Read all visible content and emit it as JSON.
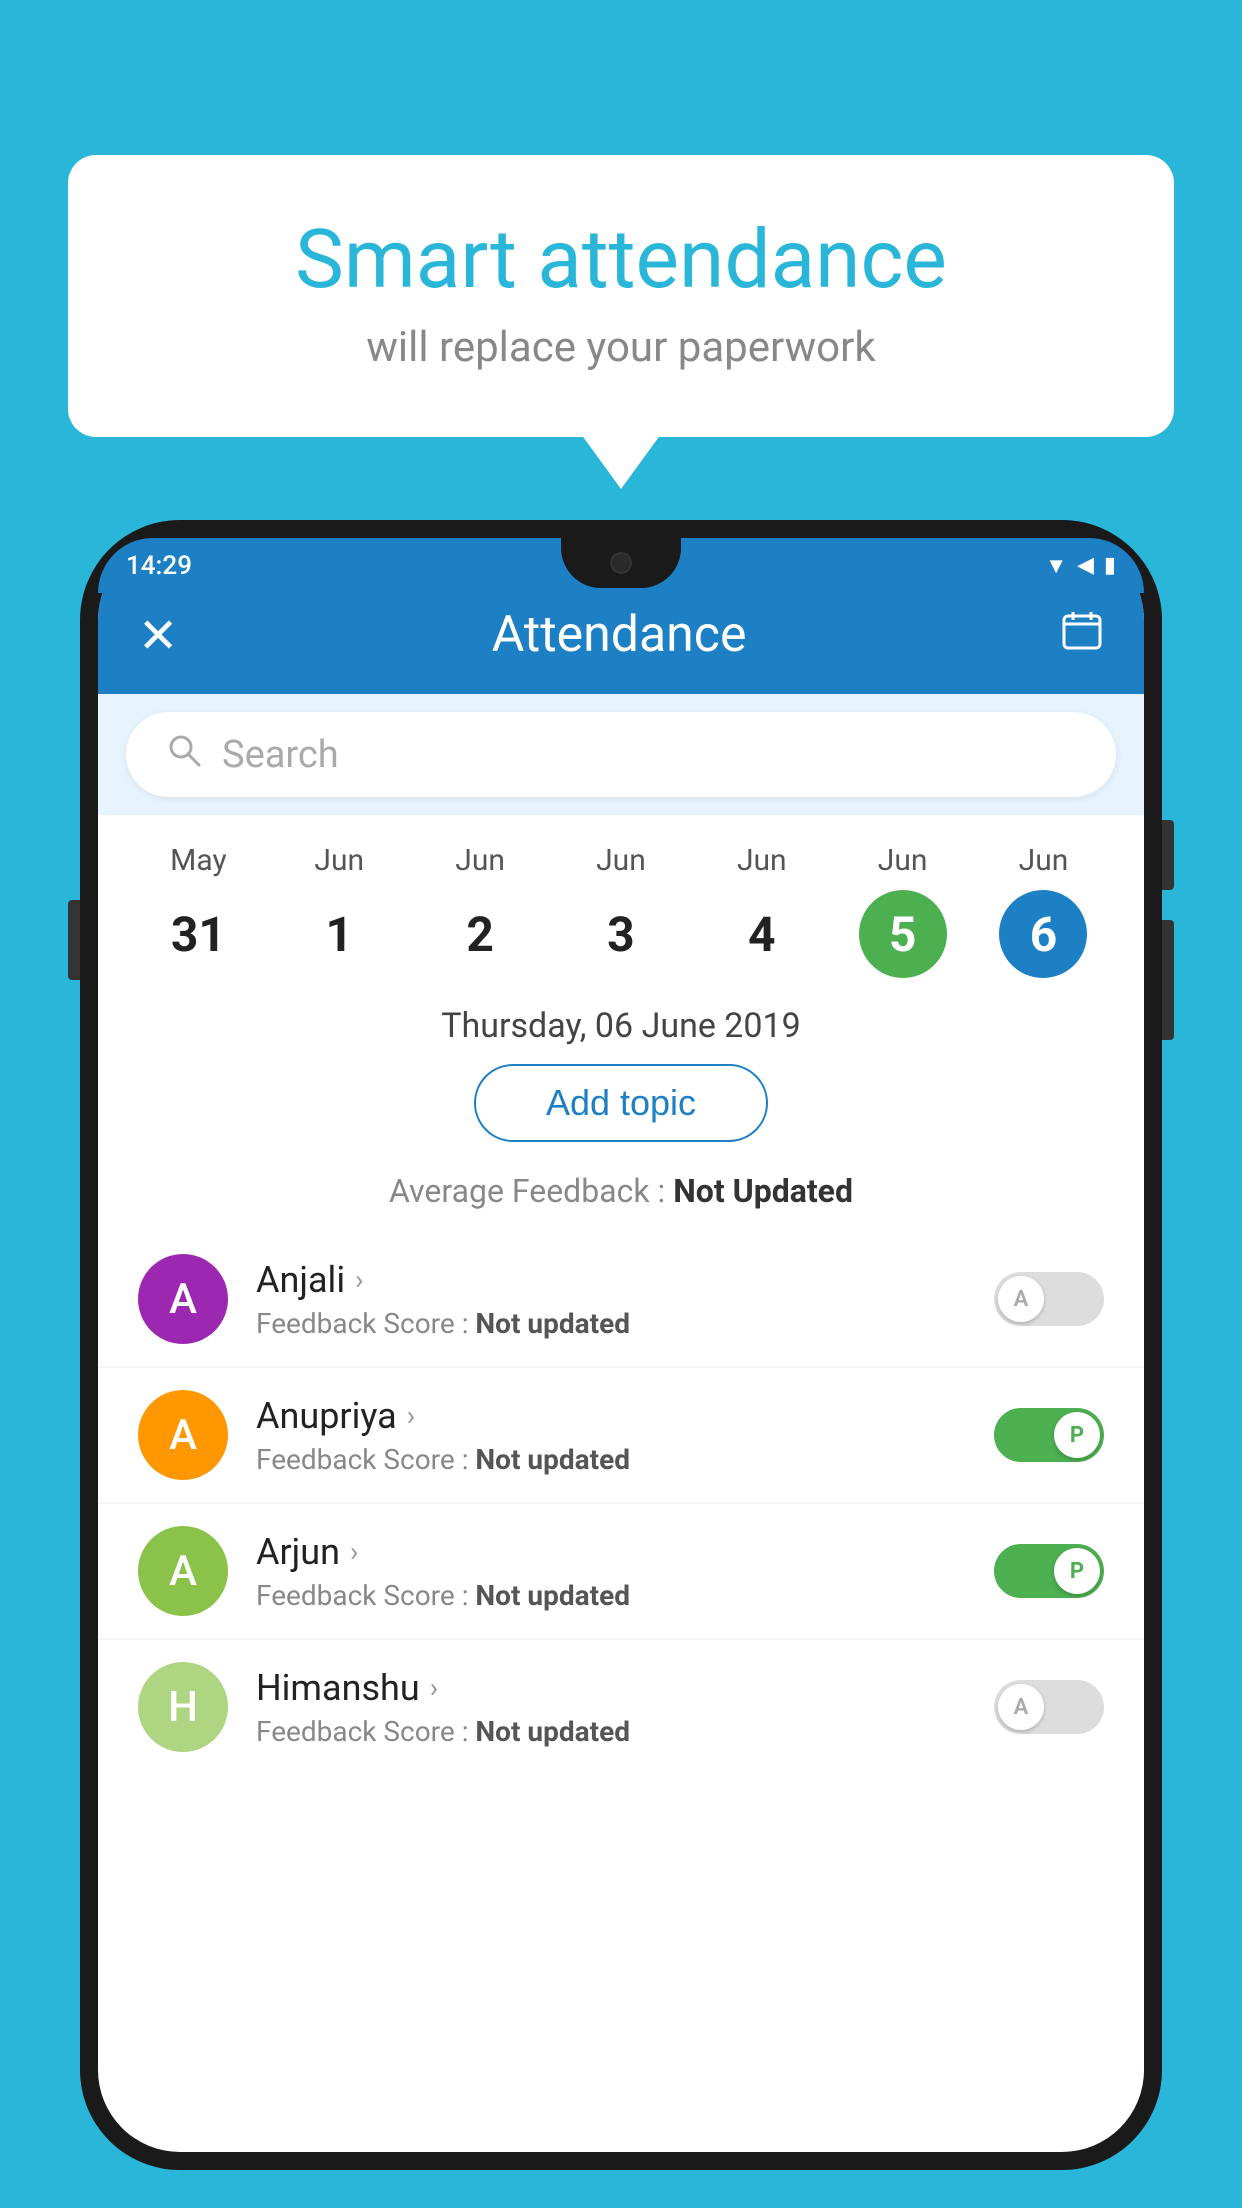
{
  "background_color": "#29b6d8",
  "bubble": {
    "title": "Smart attendance",
    "subtitle": "will replace your paperwork"
  },
  "status_bar": {
    "time": "14:29",
    "wifi_icon": "▲",
    "signal_icon": "▲",
    "battery_icon": "▮"
  },
  "app_header": {
    "close_label": "✕",
    "title": "Attendance",
    "calendar_icon": "📅"
  },
  "search": {
    "placeholder": "Search"
  },
  "calendar": {
    "days": [
      {
        "month": "May",
        "num": "31",
        "state": "normal"
      },
      {
        "month": "Jun",
        "num": "1",
        "state": "normal"
      },
      {
        "month": "Jun",
        "num": "2",
        "state": "normal"
      },
      {
        "month": "Jun",
        "num": "3",
        "state": "normal"
      },
      {
        "month": "Jun",
        "num": "4",
        "state": "normal"
      },
      {
        "month": "Jun",
        "num": "5",
        "state": "today"
      },
      {
        "month": "Jun",
        "num": "6",
        "state": "selected"
      }
    ]
  },
  "selected_date": "Thursday, 06 June 2019",
  "add_topic_label": "Add topic",
  "average_feedback": {
    "label": "Average Feedback : ",
    "value": "Not Updated"
  },
  "students": [
    {
      "name": "Anjali",
      "avatar_letter": "A",
      "avatar_color": "#9c27b0",
      "feedback_label": "Feedback Score : ",
      "feedback_value": "Not updated",
      "toggle": "off",
      "toggle_letter": "A"
    },
    {
      "name": "Anupriya",
      "avatar_letter": "A",
      "avatar_color": "#ff9800",
      "feedback_label": "Feedback Score : ",
      "feedback_value": "Not updated",
      "toggle": "on",
      "toggle_letter": "P"
    },
    {
      "name": "Arjun",
      "avatar_letter": "A",
      "avatar_color": "#8bc34a",
      "feedback_label": "Feedback Score : ",
      "feedback_value": "Not updated",
      "toggle": "on",
      "toggle_letter": "P"
    },
    {
      "name": "Himanshu",
      "avatar_letter": "H",
      "avatar_color": "#aed581",
      "feedback_label": "Feedback Score : ",
      "feedback_value": "Not updated",
      "toggle": "off",
      "toggle_letter": "A"
    }
  ]
}
